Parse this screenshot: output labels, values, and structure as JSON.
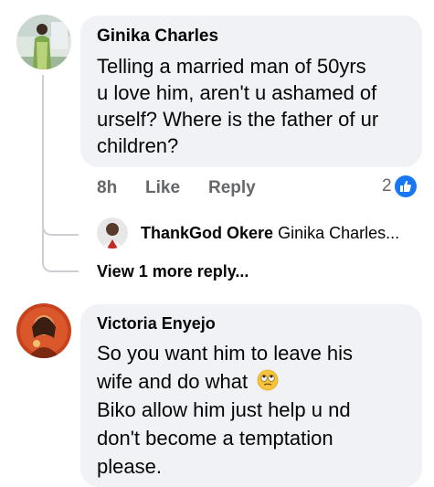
{
  "comments": [
    {
      "author": "Ginika Charles",
      "text_lines": [
        "Telling a married man of 50yrs",
        "u love him, aren't u ashamed of",
        "urself? Where is the father of ur",
        "children?"
      ],
      "time": "8h",
      "like_label": "Like",
      "reply_label": "Reply",
      "reaction_count": "2",
      "reaction_icon": "like-icon",
      "reply_preview": {
        "author": "ThankGod Okere",
        "snippet": "Ginika Charles..."
      },
      "view_more": "View 1 more reply..."
    },
    {
      "author": "Victoria Enyejo",
      "text_lines": [
        "So you want him to leave his",
        "wife and do what",
        "Biko allow him just help u nd",
        "don't become a temptation",
        "please."
      ],
      "emoji": "eye-roll-emoji"
    }
  ],
  "colors": {
    "bubble": "#f0f2f5",
    "like_blue": "#1877f2",
    "secondary_text": "#65676b",
    "thread_line": "#ccd0d5"
  }
}
